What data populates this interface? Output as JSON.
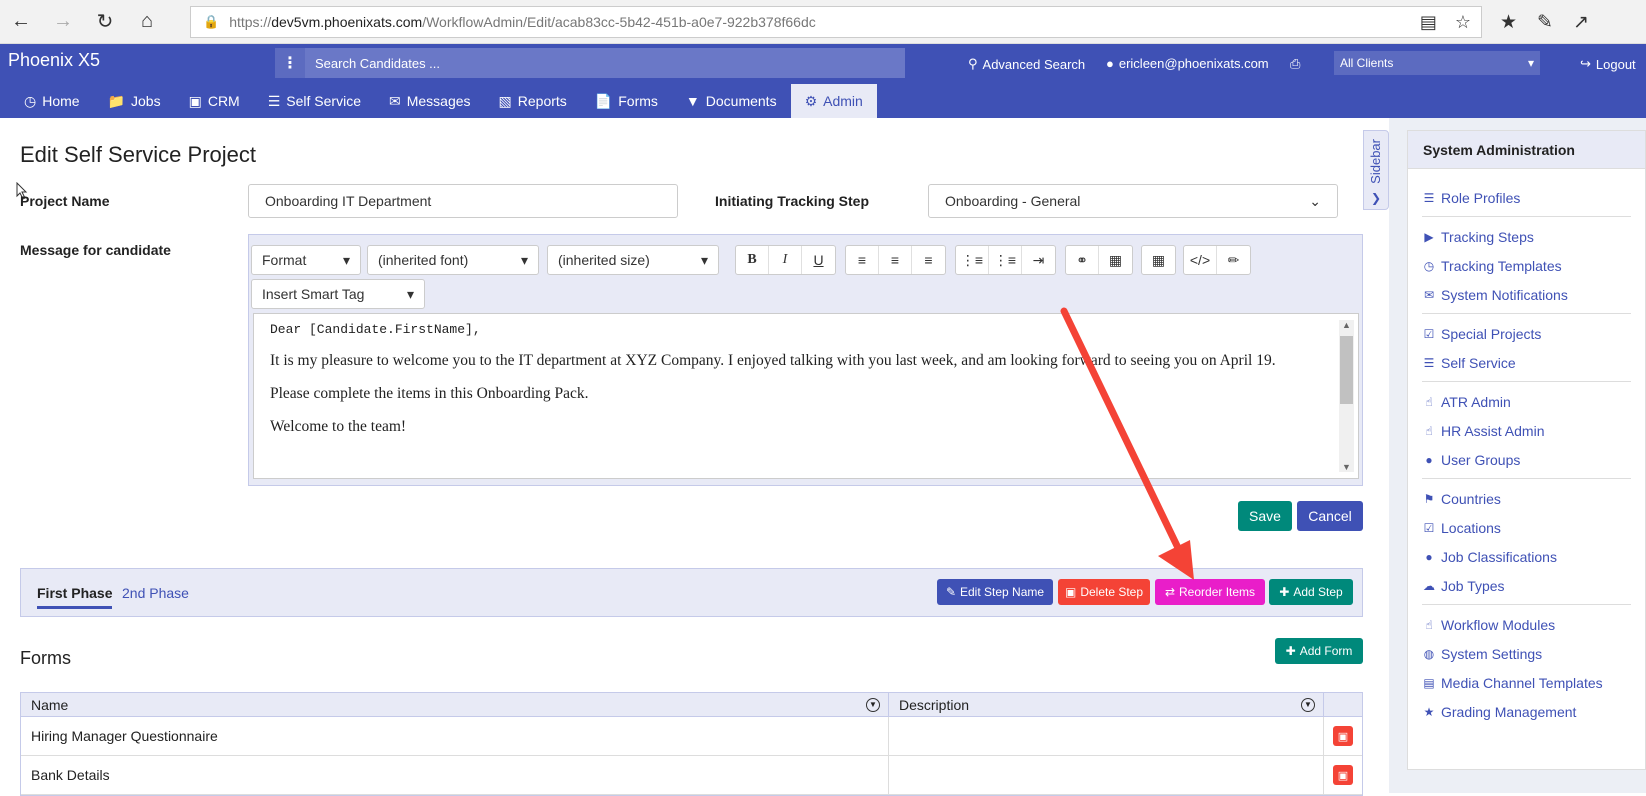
{
  "browser": {
    "url_prefix": "https://",
    "url_host": "dev5vm.phoenixats.com",
    "url_path": "/WorkflowAdmin/Edit/acab83cc-5b42-451b-a0e7-922b378f66dc"
  },
  "header": {
    "brand": "Phoenix X5",
    "search_placeholder": "Search Candidates ...",
    "advanced_search": "Advanced Search",
    "user_email": "ericleen@phoenixats.com",
    "client_select": "All Clients",
    "logout": "Logout"
  },
  "nav": {
    "tabs": [
      {
        "label": "Home",
        "icon": "clock-icon"
      },
      {
        "label": "Jobs",
        "icon": "folder-icon"
      },
      {
        "label": "CRM",
        "icon": "briefcase-icon"
      },
      {
        "label": "Self Service",
        "icon": "list-icon"
      },
      {
        "label": "Messages",
        "icon": "envelope-icon"
      },
      {
        "label": "Reports",
        "icon": "book-icon"
      },
      {
        "label": "Forms",
        "icon": "file-icon"
      },
      {
        "label": "Documents",
        "icon": "filter-icon"
      },
      {
        "label": "Admin",
        "icon": "gear-icon"
      }
    ],
    "active": "Admin"
  },
  "page": {
    "title": "Edit Self Service Project",
    "project_name_label": "Project Name",
    "project_name_value": "Onboarding IT Department",
    "tracking_step_label": "Initiating Tracking Step",
    "tracking_step_value": "Onboarding - General",
    "message_label": "Message for candidate"
  },
  "editor": {
    "format": "Format",
    "font": "(inherited font)",
    "size": "(inherited size)",
    "smart_tag": "Insert Smart Tag",
    "greeting": "Dear [Candidate.FirstName],",
    "para1": "It is my pleasure to welcome you to the IT department at XYZ Company. I enjoyed talking with you last week, and am looking forward to seeing you on April 19.",
    "para2": "Please complete the items in this Onboarding Pack.",
    "para3": "Welcome to the team!"
  },
  "actions": {
    "save": "Save",
    "cancel": "Cancel"
  },
  "steps": {
    "tabs": [
      "First Phase",
      "2nd Phase"
    ],
    "active": "First Phase",
    "edit_step_name": "Edit Step Name",
    "delete_step": "Delete Step",
    "reorder_items": "Reorder Items",
    "add_step": "Add Step"
  },
  "forms": {
    "title": "Forms",
    "add_form": "Add Form",
    "columns": [
      "Name",
      "Description"
    ],
    "rows": [
      {
        "name": "Hiring Manager Questionnaire",
        "description": ""
      },
      {
        "name": "Bank Details",
        "description": ""
      }
    ]
  },
  "sidebar_toggle": "Sidebar",
  "admin_panel": {
    "title": "System Administration",
    "groups": [
      [
        {
          "label": "Role Profiles",
          "icon": "list-icon"
        }
      ],
      [
        {
          "label": "Tracking Steps",
          "icon": "step-icon"
        },
        {
          "label": "Tracking Templates",
          "icon": "clock-icon"
        },
        {
          "label": "System Notifications",
          "icon": "envelope-icon"
        }
      ],
      [
        {
          "label": "Special Projects",
          "icon": "check-icon"
        },
        {
          "label": "Self Service",
          "icon": "list-icon"
        }
      ],
      [
        {
          "label": "ATR Admin",
          "icon": "thumbs-up-icon"
        },
        {
          "label": "HR Assist Admin",
          "icon": "thumbs-up-icon"
        },
        {
          "label": "User Groups",
          "icon": "user-icon"
        }
      ],
      [
        {
          "label": "Countries",
          "icon": "flag-icon"
        },
        {
          "label": "Locations",
          "icon": "check-icon"
        },
        {
          "label": "Job Classifications",
          "icon": "user-icon"
        },
        {
          "label": "Job Types",
          "icon": "cloud-icon"
        }
      ],
      [
        {
          "label": "Workflow Modules",
          "icon": "thumbs-up-icon"
        },
        {
          "label": "System Settings",
          "icon": "globe-icon"
        },
        {
          "label": "Media Channel Templates",
          "icon": "file-icon"
        },
        {
          "label": "Grading Management",
          "icon": "star-icon"
        }
      ]
    ]
  },
  "colors": {
    "primary": "#3f51b5",
    "save": "#00897b",
    "cancel": "#3f51b5",
    "delete": "#f44336",
    "reorder": "#e91ec9",
    "annotation_arrow": "#f44336"
  }
}
